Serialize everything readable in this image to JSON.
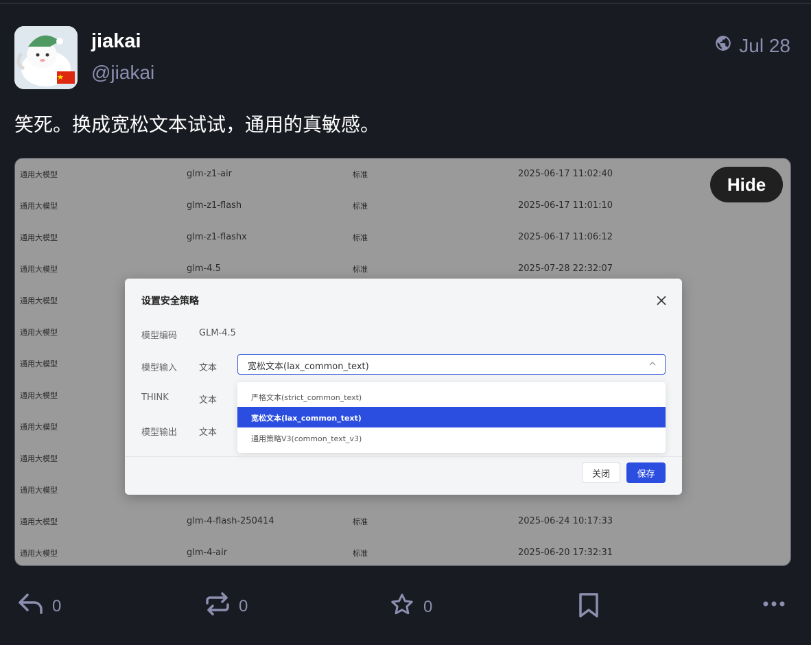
{
  "post": {
    "display_name": "jiakai",
    "handle": "@jiakai",
    "date": "Jul 28",
    "visibility_icon": "globe-icon",
    "text": "笑死。换成宽松文本试试，通用的真敏感。"
  },
  "media": {
    "hide_label": "Hide",
    "rows": [
      {
        "c1": "通用大模型",
        "c2": "glm-z1-air",
        "c3": "标准",
        "c4": "2025-06-17 11:02:40"
      },
      {
        "c1": "通用大模型",
        "c2": "glm-z1-flash",
        "c3": "标准",
        "c4": "2025-06-17 11:01:10"
      },
      {
        "c1": "通用大模型",
        "c2": "glm-z1-flashx",
        "c3": "标准",
        "c4": "2025-06-17 11:06:12"
      },
      {
        "c1": "通用大模型",
        "c2": "glm-4.5",
        "c3": "标准",
        "c4": "2025-07-28 22:32:07"
      },
      {
        "c1": "通用大模型",
        "c2": "",
        "c3": "",
        "c4": ""
      },
      {
        "c1": "通用大模型",
        "c2": "",
        "c3": "",
        "c4": ""
      },
      {
        "c1": "通用大模型",
        "c2": "",
        "c3": "",
        "c4": ""
      },
      {
        "c1": "通用大模型",
        "c2": "",
        "c3": "",
        "c4": ""
      },
      {
        "c1": "通用大模型",
        "c2": "",
        "c3": "",
        "c4": ""
      },
      {
        "c1": "通用大模型",
        "c2": "",
        "c3": "",
        "c4": ""
      },
      {
        "c1": "通用大模型",
        "c2": "",
        "c3": "",
        "c4": ""
      },
      {
        "c1": "通用大模型",
        "c2": "glm-4-flash-250414",
        "c3": "标准",
        "c4": "2025-06-24 10:17:33"
      },
      {
        "c1": "通用大模型",
        "c2": "glm-4-air",
        "c3": "标准",
        "c4": "2025-06-20 17:32:31"
      }
    ],
    "dialog": {
      "title": "设置安全策略",
      "model_code_label": "模型编码",
      "model_code_value": "GLM-4.5",
      "input_label": "模型输入",
      "input_type": "文本",
      "selected": "宽松文本(lax_common_text)",
      "think_label": "THINK",
      "think_type": "文本",
      "output_label": "模型输出",
      "output_type": "文本",
      "options": [
        "严格文本(strict_common_text)",
        "宽松文本(lax_common_text)",
        "通用策略V3(common_text_v3)"
      ],
      "close_label": "关闭",
      "save_label": "保存"
    }
  },
  "actions": {
    "reply_count": "0",
    "boost_count": "0",
    "favourite_count": "0"
  },
  "colors": {
    "background": "#191b22",
    "muted": "#8d8fb1",
    "accent": "#2b4ee0"
  }
}
